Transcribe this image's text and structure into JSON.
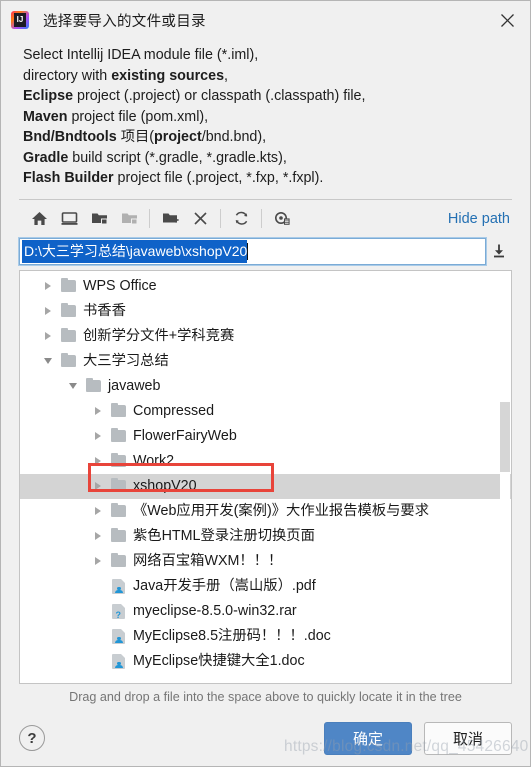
{
  "window": {
    "title": "选择要导入的文件或目录",
    "app_icon": "intellij-idea-icon",
    "close_icon": "close-icon"
  },
  "description": {
    "lines": [
      [
        {
          "t": "Select Intellij IDEA module file (*.iml),",
          "b": false
        }
      ],
      [
        {
          "t": "directory with ",
          "b": false
        },
        {
          "t": "existing sources",
          "b": true
        },
        {
          "t": ",",
          "b": false
        }
      ],
      [
        {
          "t": "Eclipse",
          "b": true
        },
        {
          "t": " project (.project) or classpath (.classpath) file,",
          "b": false
        }
      ],
      [
        {
          "t": "Maven",
          "b": true
        },
        {
          "t": " project file (pom.xml),",
          "b": false
        }
      ],
      [
        {
          "t": "Bnd/Bndtools",
          "b": true
        },
        {
          "t": " 项目(",
          "b": false
        },
        {
          "t": "project",
          "b": true
        },
        {
          "t": "/bnd.bnd),",
          "b": false
        }
      ],
      [
        {
          "t": "Gradle",
          "b": true
        },
        {
          "t": " build script (*.gradle, *.gradle.kts),",
          "b": false
        }
      ],
      [
        {
          "t": "Flash Builder",
          "b": true
        },
        {
          "t": " project file (.project, *.fxp, *.fxpl).",
          "b": false
        }
      ]
    ]
  },
  "toolbar": {
    "buttons": [
      {
        "name": "home-icon",
        "tooltip": "Home",
        "disabled": false
      },
      {
        "name": "desktop-icon",
        "tooltip": "Desktop",
        "disabled": false
      },
      {
        "name": "project-folder-icon",
        "tooltip": "Project Directory",
        "disabled": false
      },
      {
        "name": "module-folder-icon",
        "tooltip": "Module Directory",
        "disabled": true
      },
      {
        "name": "new-folder-icon",
        "tooltip": "New Folder",
        "disabled": false
      },
      {
        "name": "delete-icon",
        "tooltip": "Delete",
        "disabled": false
      },
      {
        "name": "refresh-icon",
        "tooltip": "Refresh",
        "disabled": false
      },
      {
        "name": "show-hidden-files-icon",
        "tooltip": "Show Hidden Files",
        "disabled": false
      }
    ],
    "hide_path_label": "Hide path"
  },
  "path_field": {
    "value": "D:\\大三学习总结\\javaweb\\xshopV20",
    "selected": true,
    "dropdown_icon": "download-arrow-icon"
  },
  "tree": {
    "items": [
      {
        "label": "WPS Office",
        "level": 1,
        "type": "folder",
        "state": "collapsed",
        "selected": false
      },
      {
        "label": "书香香",
        "level": 1,
        "type": "folder",
        "state": "collapsed",
        "selected": false
      },
      {
        "label": "创新学分文件+学科竞赛",
        "level": 1,
        "type": "folder",
        "state": "collapsed",
        "selected": false
      },
      {
        "label": "大三学习总结",
        "level": 1,
        "type": "folder",
        "state": "expanded",
        "selected": false
      },
      {
        "label": "javaweb",
        "level": 2,
        "type": "folder",
        "state": "expanded",
        "selected": false
      },
      {
        "label": "Compressed",
        "level": 3,
        "type": "folder",
        "state": "collapsed",
        "selected": false
      },
      {
        "label": "FlowerFairyWeb",
        "level": 3,
        "type": "folder",
        "state": "collapsed",
        "selected": false
      },
      {
        "label": "Work2",
        "level": 3,
        "type": "folder",
        "state": "collapsed",
        "selected": false
      },
      {
        "label": "xshopV20",
        "level": 3,
        "type": "folder",
        "state": "collapsed",
        "selected": true
      },
      {
        "label": "《Web应用开发(案例)》大作业报告模板与要求",
        "level": 3,
        "type": "folder",
        "state": "collapsed",
        "selected": false
      },
      {
        "label": "紫色HTML登录注册切换页面",
        "level": 3,
        "type": "folder",
        "state": "collapsed",
        "selected": false
      },
      {
        "label": "网络百宝箱WXM！！！",
        "level": 3,
        "type": "folder",
        "state": "collapsed",
        "selected": false
      },
      {
        "label": "Java开发手册（嵩山版）.pdf",
        "level": 3,
        "type": "file",
        "state": "leaf",
        "selected": false
      },
      {
        "label": "myeclipse-8.5.0-win32.rar",
        "level": 3,
        "type": "file-unknown",
        "state": "leaf",
        "selected": false
      },
      {
        "label": "MyEclipse8.5注册码！！！.doc",
        "level": 3,
        "type": "file",
        "state": "leaf",
        "selected": false
      },
      {
        "label": "MyEclipse快捷键大全1.doc",
        "level": 3,
        "type": "file",
        "state": "leaf",
        "selected": false
      }
    ],
    "annotation_color": "#e8443a",
    "selection_color": "#d4d4d4"
  },
  "hint": "Drag and drop a file into the space above to quickly locate it in the tree",
  "footer": {
    "help_label": "?",
    "ok_label": "确定",
    "cancel_label": "取消",
    "ok_color": "#4f86c6"
  },
  "watermark": "https://blog.csdn.net/qq_45426640"
}
